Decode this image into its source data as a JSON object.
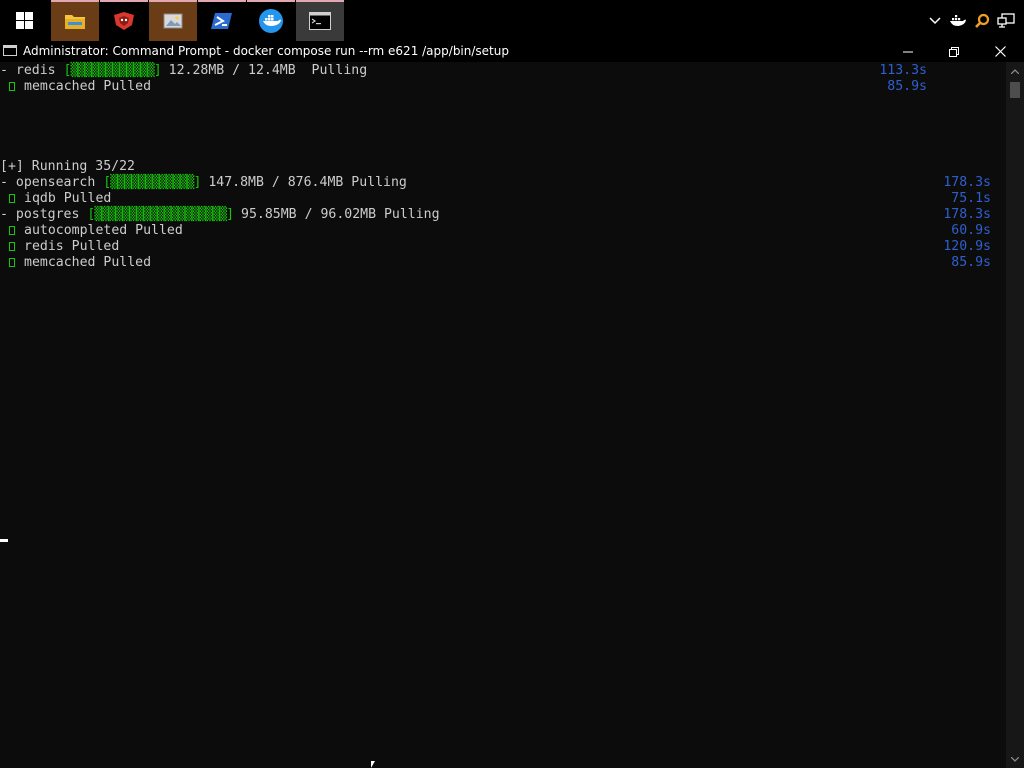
{
  "taskbar": {
    "apps": [
      {
        "name": "file-explorer",
        "active": false,
        "pinned": true
      },
      {
        "name": "gitkraken",
        "active": false,
        "pinned": false
      },
      {
        "name": "photo-viewer",
        "active": false,
        "pinned": true
      },
      {
        "name": "powershell",
        "active": false,
        "pinned": false
      },
      {
        "name": "docker-desktop",
        "active": false,
        "pinned": false
      },
      {
        "name": "command-prompt",
        "active": true,
        "pinned": false
      }
    ],
    "tray_icons": [
      "chevron-up-icon",
      "docker-whale-icon",
      "search-icon",
      "network-icon"
    ]
  },
  "window": {
    "title": "Administrator: Command Prompt - docker  compose run --rm e621 /app/bin/setup",
    "minimize_glyph": "—",
    "restore_glyph": "❐",
    "close_glyph": "✕"
  },
  "console": {
    "top_block": [
      {
        "prefix": "- ",
        "name": "redis",
        "bar": "[▒▒▒▒▒▒▒▒▒▒▒▒]",
        "detail": " 12.28MB / 12.4MB  Pulling",
        "time": "113.3s",
        "status": "pulling"
      },
      {
        "prefix": "check",
        "name": "memcached",
        "bar": "",
        "detail": " Pulled",
        "time": "85.9s",
        "status": "done"
      }
    ],
    "running_header": "[+] Running 35/22",
    "main_block": [
      {
        "prefix": "- ",
        "name": "opensearch",
        "bar": "[▒▒▒▒▒▒▒▒▒▒▒▒]",
        "detail": " 147.8MB / 876.4MB Pulling",
        "time": "178.3s",
        "status": "pulling"
      },
      {
        "prefix": "check",
        "name": "iqdb",
        "bar": "",
        "detail": " Pulled",
        "time": "75.1s",
        "status": "done"
      },
      {
        "prefix": "- ",
        "name": "postgres",
        "bar": "[▒▒▒▒▒▒▒▒▒▒▒▒▒▒▒▒▒▒▒]",
        "detail": " 95.85MB / 96.02MB Pulling",
        "time": "178.3s",
        "status": "pulling"
      },
      {
        "prefix": "check",
        "name": "autocompleted",
        "bar": "",
        "detail": " Pulled",
        "time": "60.9s",
        "status": "done"
      },
      {
        "prefix": "check",
        "name": "redis",
        "bar": "",
        "detail": " Pulled",
        "time": "120.9s",
        "status": "done"
      },
      {
        "prefix": "check",
        "name": "memcached",
        "bar": "",
        "detail": " Pulled",
        "time": "85.9s",
        "status": "done"
      }
    ]
  },
  "colors": {
    "background": "#0c0c0c",
    "text": "#cccccc",
    "progress": "#16c60c",
    "time": "#2f5fd0"
  }
}
